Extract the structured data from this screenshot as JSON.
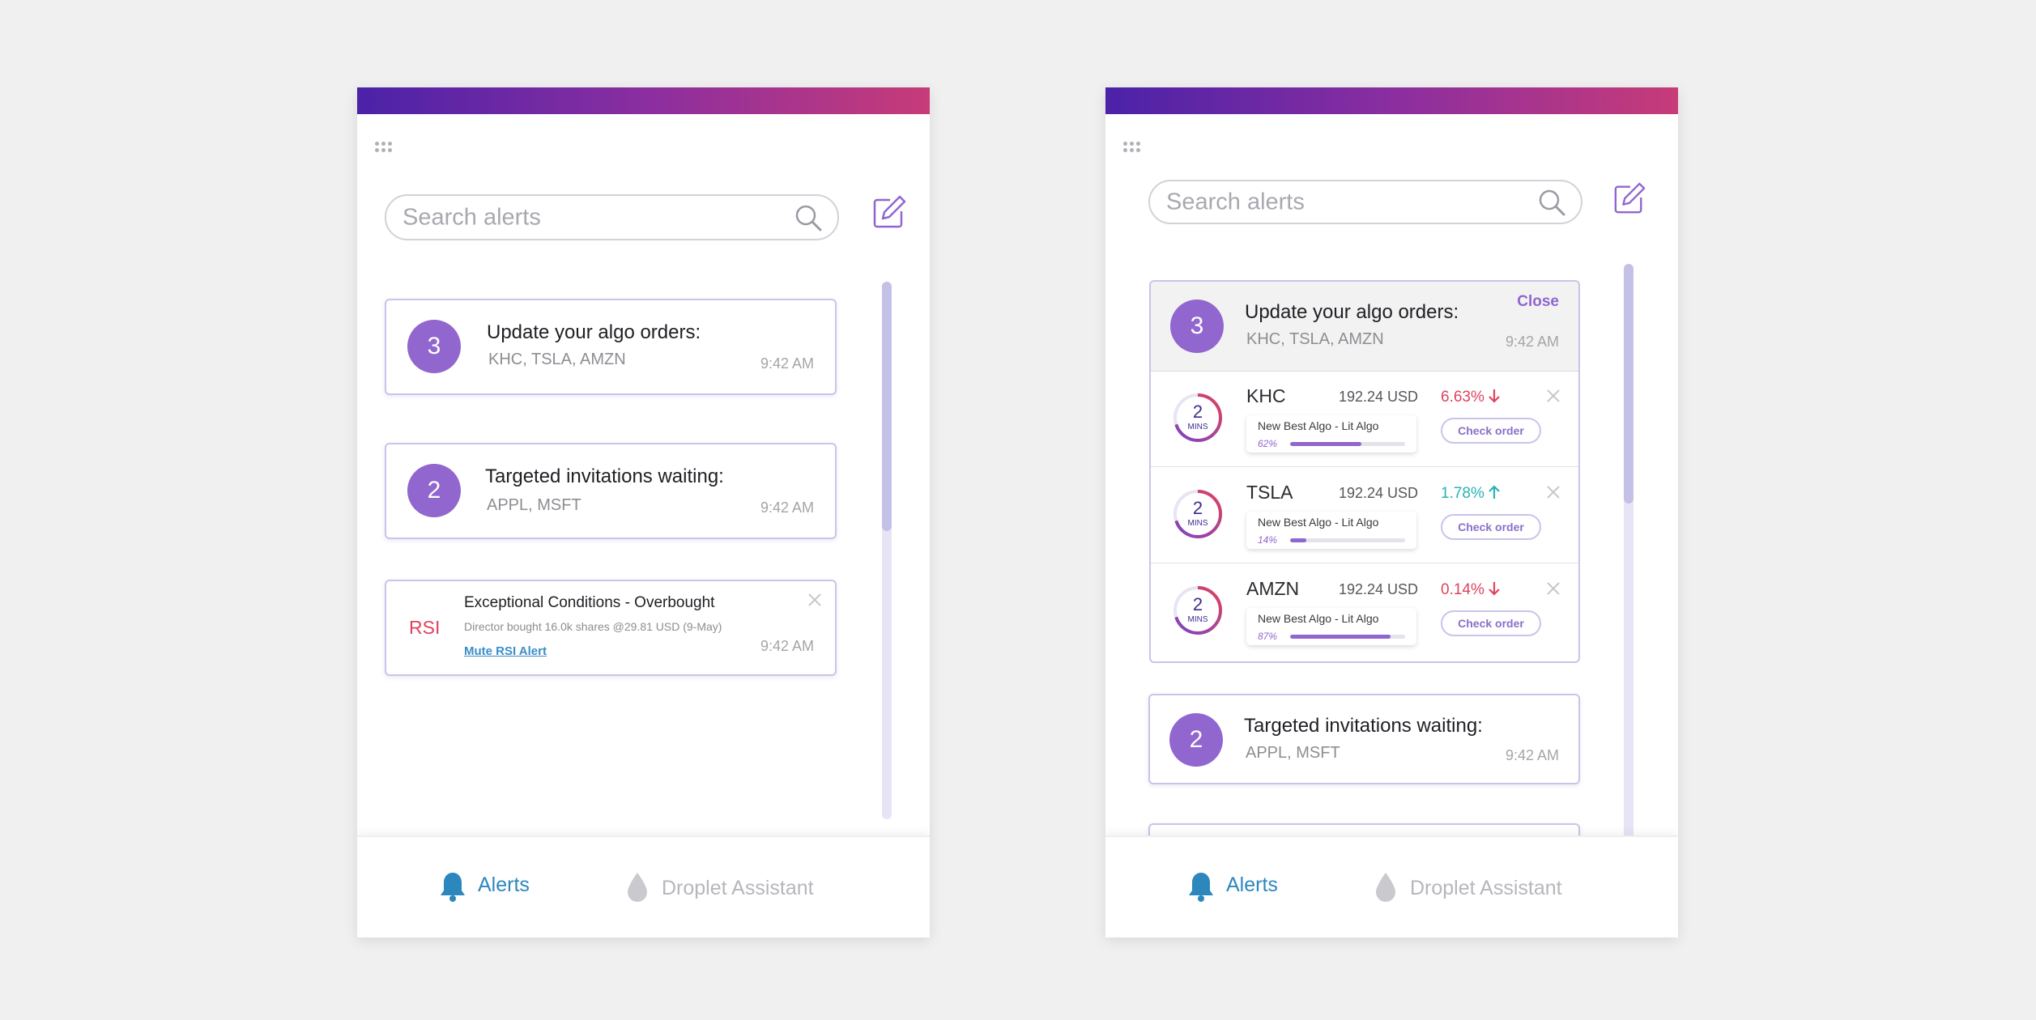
{
  "search": {
    "placeholder": "Search alerts"
  },
  "alerts": {
    "algo_orders": {
      "count": "3",
      "title": "Update your algo orders:",
      "tickers": "KHC, TSLA, AMZN",
      "time": "9:42 AM"
    },
    "invitations": {
      "count": "2",
      "title": "Targeted invitations waiting:",
      "tickers": "APPL, MSFT",
      "time": "9:42 AM"
    },
    "rsi": {
      "badge": "RSI",
      "title": "Exceptional Conditions - Overbought",
      "description": "Director bought 16.0k shares @29.81 USD (9-May)",
      "mute_link": "Mute RSI Alert",
      "time": "9:42 AM"
    }
  },
  "expanded": {
    "close_label": "Close",
    "rows": [
      {
        "symbol": "KHC",
        "price": "192.24 USD",
        "change": "6.63%",
        "direction": "down",
        "timer_value": "2",
        "timer_unit": "MINS",
        "algo_name": "New Best Algo - Lit Algo",
        "progress_label": "62%",
        "progress": 0.62,
        "check_label": "Check order"
      },
      {
        "symbol": "TSLA",
        "price": "192.24 USD",
        "change": "1.78%",
        "direction": "up",
        "timer_value": "2",
        "timer_unit": "MINS",
        "algo_name": "New Best Algo - Lit Algo",
        "progress_label": "14%",
        "progress": 0.14,
        "check_label": "Check order"
      },
      {
        "symbol": "AMZN",
        "price": "192.24 USD",
        "change": "0.14%",
        "direction": "down",
        "timer_value": "2",
        "timer_unit": "MINS",
        "algo_name": "New Best Algo - Lit Algo",
        "progress_label": "87%",
        "progress": 0.87,
        "check_label": "Check order"
      }
    ]
  },
  "nav": {
    "alerts_label": "Alerts",
    "droplet_label": "Droplet Assistant"
  },
  "colors": {
    "accent": "#9166cf",
    "alerts_blue": "#2c87bd",
    "down": "#e0425e",
    "up": "#25b4b3",
    "gradient_start": "#4b22a8",
    "gradient_end": "#c73b78"
  },
  "icons": [
    "apps-grid-icon",
    "search-icon",
    "compose-icon",
    "close-icon",
    "bell-icon",
    "droplet-icon",
    "arrow-down-icon",
    "arrow-up-icon"
  ]
}
